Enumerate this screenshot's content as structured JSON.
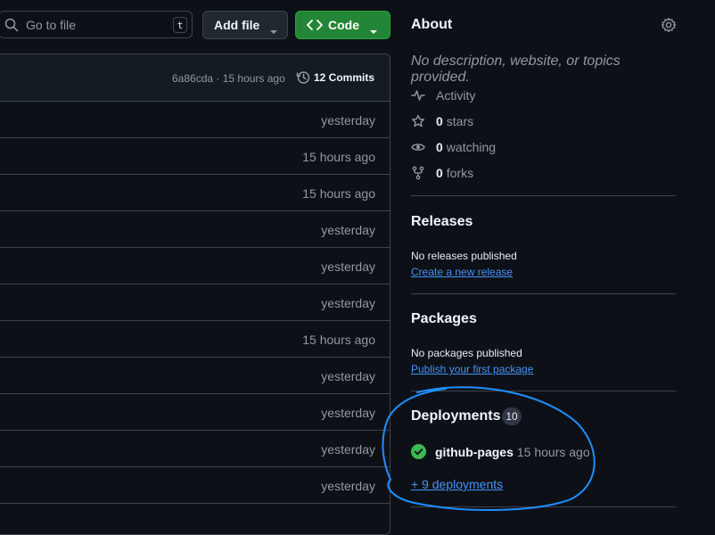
{
  "toolbar": {
    "search_placeholder": "Go to file",
    "search_shortcut": "t",
    "add_file_label": "Add file",
    "code_label": "Code"
  },
  "commit_header": {
    "meta": "6a86cda · 15 hours ago",
    "commits_label": "12 Commits"
  },
  "files": {
    "rows": [
      {
        "time": "yesterday"
      },
      {
        "time": "15 hours ago"
      },
      {
        "time": "15 hours ago"
      },
      {
        "time": "yesterday"
      },
      {
        "time": "yesterday"
      },
      {
        "time": "yesterday"
      },
      {
        "time": "15 hours ago"
      },
      {
        "time": "yesterday"
      },
      {
        "time": "yesterday"
      },
      {
        "time": "yesterday"
      },
      {
        "time": "yesterday"
      }
    ]
  },
  "about": {
    "title": "About",
    "description": "No description, website, or topics provided.",
    "activity_label": "Activity",
    "stars_count": "0",
    "stars_label": "stars",
    "watching_count": "0",
    "watching_label": "watching",
    "forks_count": "0",
    "forks_label": "forks"
  },
  "releases": {
    "title": "Releases",
    "empty_text": "No releases published",
    "create_link": "Create a new release"
  },
  "packages": {
    "title": "Packages",
    "empty_text": "No packages published",
    "publish_link": "Publish your first package"
  },
  "deployments": {
    "title": "Deployments",
    "count": "10",
    "item_name": "github-pages",
    "item_time": "15 hours ago",
    "more_link": "+ 9 deployments"
  },
  "colors": {
    "background": "#0d1117",
    "border": "#3d444d",
    "accent_link": "#4493f8",
    "code_button": "#238636",
    "success": "#3fb950",
    "annotation": "#1f8fff"
  }
}
